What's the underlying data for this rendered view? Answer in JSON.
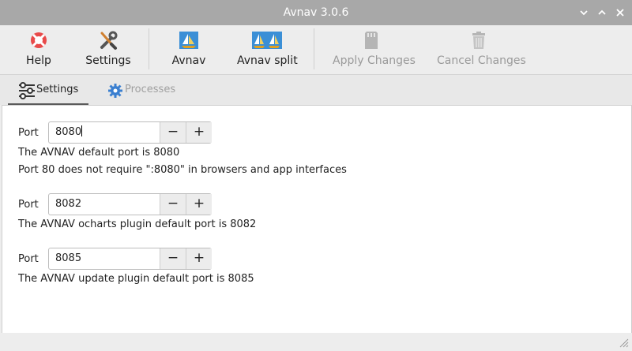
{
  "window": {
    "title": "Avnav 3.0.6"
  },
  "toolbar": {
    "help": "Help",
    "settings": "Settings",
    "avnav": "Avnav",
    "avnav_split": "Avnav split",
    "apply": "Apply Changes",
    "cancel": "Cancel Changes"
  },
  "tabs": {
    "settings": "Settings",
    "processes": "Processes"
  },
  "ports": [
    {
      "label": "Port",
      "value": "8080",
      "desc": [
        "The AVNAV default port is 8080",
        "Port 80 does not require \":8080\" in browsers and app interfaces"
      ]
    },
    {
      "label": "Port",
      "value": "8082",
      "desc": [
        "The AVNAV ocharts plugin default port is 8082"
      ]
    },
    {
      "label": "Port",
      "value": "8085",
      "desc": [
        "The AVNAV update plugin default port is 8085"
      ]
    }
  ],
  "spin": {
    "minus": "−",
    "plus": "+"
  },
  "colors": {
    "titlebar": "#a8a8a8",
    "accent": "#1e6fd9",
    "disabled": "#9a9a9a"
  }
}
